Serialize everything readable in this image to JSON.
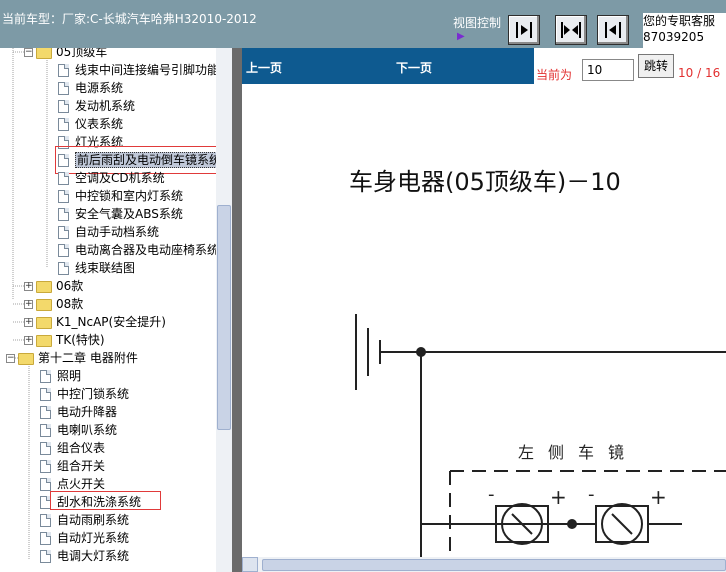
{
  "header": {
    "car_model": "当前车型：厂家:C-长城汽车哈弗H32010-2012",
    "view_control_label": "视图控制",
    "info_line1": "您的专职客服",
    "info_line2": "87039205"
  },
  "tree": {
    "items": [
      {
        "label": "05顶级车",
        "type": "folder",
        "expanded": true
      },
      {
        "label": "线束中间连接编号引脚功能",
        "type": "doc"
      },
      {
        "label": "电源系统",
        "type": "doc"
      },
      {
        "label": "发动机系统",
        "type": "doc"
      },
      {
        "label": "仪表系统",
        "type": "doc"
      },
      {
        "label": "灯光系统",
        "type": "doc"
      },
      {
        "label": "前后雨刮及电动倒车镜系统",
        "type": "doc",
        "selected": true
      },
      {
        "label": "空调及CD机系统",
        "type": "doc"
      },
      {
        "label": "中控锁和室内灯系统",
        "type": "doc"
      },
      {
        "label": "安全气囊及ABS系统",
        "type": "doc"
      },
      {
        "label": "自动手动档系统",
        "type": "doc"
      },
      {
        "label": "电动离合器及电动座椅系统",
        "type": "doc"
      },
      {
        "label": "线束联结图",
        "type": "doc"
      },
      {
        "label": "06款",
        "type": "folder"
      },
      {
        "label": "08款",
        "type": "folder"
      },
      {
        "label": "K1_NcAP(安全提升)",
        "type": "folder"
      },
      {
        "label": "TK(特快)",
        "type": "folder"
      },
      {
        "label": "第十二章  电器附件",
        "type": "folder",
        "expanded": true
      },
      {
        "label": "照明",
        "type": "doc"
      },
      {
        "label": "中控门锁系统",
        "type": "doc"
      },
      {
        "label": "电动升降器",
        "type": "doc"
      },
      {
        "label": "电喇叭系统",
        "type": "doc"
      },
      {
        "label": "组合仪表",
        "type": "doc"
      },
      {
        "label": "组合开关",
        "type": "doc"
      },
      {
        "label": "点火开关",
        "type": "doc"
      },
      {
        "label": "刮水和洗涤系统",
        "type": "doc"
      },
      {
        "label": "自动雨刷系统",
        "type": "doc"
      },
      {
        "label": "自动灯光系统",
        "type": "doc"
      },
      {
        "label": "电调大灯系统",
        "type": "doc"
      }
    ]
  },
  "nav": {
    "prev_label": "上一页",
    "next_label": "下一页",
    "current_label": "当前为",
    "page_value": "10",
    "jump_label": "跳转",
    "page_total": "10 / 16"
  },
  "document": {
    "title": "车身电器(05顶级车)－10",
    "diagram_label": "左侧车镜",
    "terminal_minus": "-",
    "terminal_plus": "+"
  },
  "colors": {
    "header_bg": "#7d9aa6",
    "nav_bg": "#0e5a90",
    "highlight_red": "#e03a3a"
  }
}
